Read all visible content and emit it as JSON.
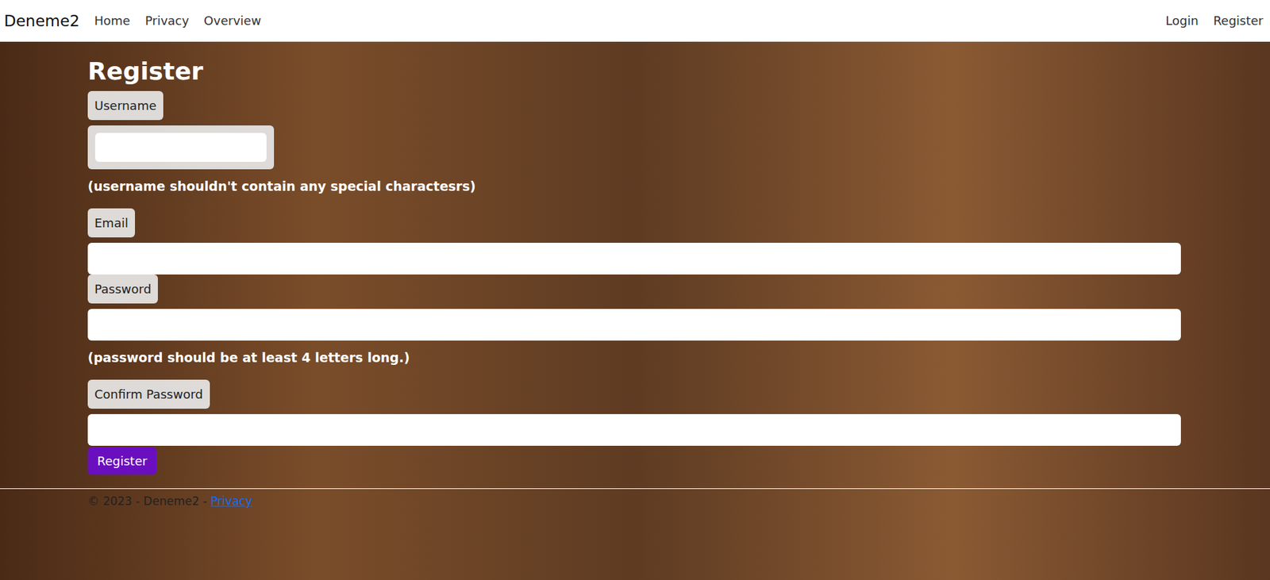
{
  "navbar": {
    "brand": "Deneme2",
    "links": [
      "Home",
      "Privacy",
      "Overview"
    ],
    "auth_links": [
      "Login",
      "Register"
    ]
  },
  "form": {
    "title": "Register",
    "fields": [
      {
        "label": "Username",
        "kind": "compact",
        "value": "",
        "hint": "(username shouldn't contain any special charactesrs)"
      },
      {
        "label": "Email",
        "kind": "wide",
        "value": "",
        "hint": ""
      },
      {
        "label": "Password",
        "kind": "wide",
        "value": "",
        "hint": "(password should be at least 4 letters long.)"
      },
      {
        "label": "Confirm Password",
        "kind": "wide",
        "value": "",
        "hint": ""
      }
    ],
    "submit": "Register"
  },
  "footer": {
    "text": "© 2023 - Deneme2 - ",
    "link": "Privacy"
  }
}
